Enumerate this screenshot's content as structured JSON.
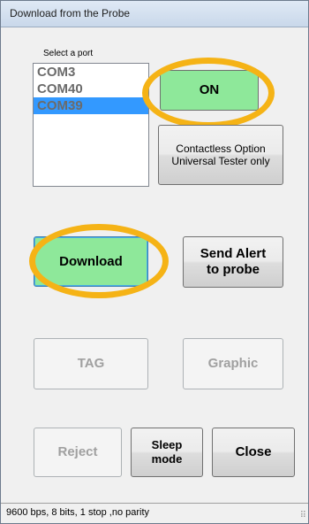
{
  "window": {
    "title": "Download from the  Probe"
  },
  "port_selector": {
    "label": "Select a port",
    "items": [
      {
        "label": "COM3",
        "selected": false
      },
      {
        "label": "COM40",
        "selected": false
      },
      {
        "label": "COM39",
        "selected": true
      }
    ]
  },
  "buttons": {
    "on": "ON",
    "contactless_line1": "Contactless Option",
    "contactless_line2": "Universal Tester only",
    "download": "Download",
    "send_alert_line1": "Send Alert",
    "send_alert_line2": "to probe",
    "tag": "TAG",
    "graphic": "Graphic",
    "reject": "Reject",
    "sleep_line1": "Sleep",
    "sleep_line2": "mode",
    "close": "Close"
  },
  "status_bar": {
    "text": "9600 bps, 8 bits, 1 stop ,no parity"
  },
  "colors": {
    "highlight_ring": "#f5b316",
    "active_green": "#8ee89a",
    "selection": "#3399ff"
  }
}
